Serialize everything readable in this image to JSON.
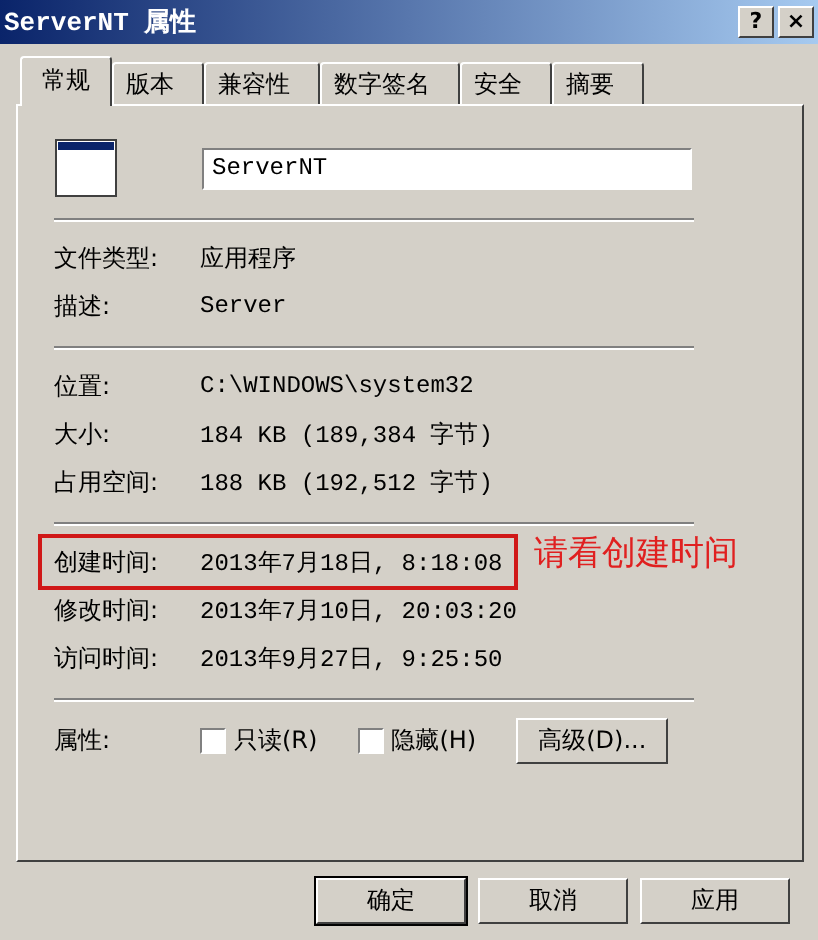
{
  "window": {
    "title": "ServerNT 属性",
    "help_button": "?",
    "close_button": "×"
  },
  "tabs": [
    {
      "label": "常规",
      "selected": true
    },
    {
      "label": "版本",
      "selected": false
    },
    {
      "label": "兼容性",
      "selected": false
    },
    {
      "label": "数字签名",
      "selected": false
    },
    {
      "label": "安全",
      "selected": false
    },
    {
      "label": "摘要",
      "selected": false
    }
  ],
  "name_field": {
    "value": "ServerNT"
  },
  "groups": [
    [
      {
        "label": "文件类型:",
        "value": "应用程序",
        "kind": "text",
        "highlighted": false
      },
      {
        "label": "描述:",
        "value": "Server",
        "kind": "mono",
        "highlighted": false
      }
    ],
    [
      {
        "label": "位置:",
        "value": "C:\\WINDOWS\\system32",
        "kind": "mono",
        "highlighted": false
      },
      {
        "label": "大小:",
        "value": "184 KB (189,384 字节)",
        "kind": "mono",
        "highlighted": false
      },
      {
        "label": "占用空间:",
        "value": "188 KB (192,512 字节)",
        "kind": "mono",
        "highlighted": false
      }
    ],
    [
      {
        "label": "创建时间:",
        "value": "2013年7月18日, 8:18:08",
        "kind": "mono",
        "highlighted": true,
        "annotation": "请看创建时间"
      },
      {
        "label": "修改时间:",
        "value": "2013年7月10日, 20:03:20",
        "kind": "mono",
        "highlighted": false
      },
      {
        "label": "访问时间:",
        "value": "2013年9月27日, 9:25:50",
        "kind": "mono",
        "highlighted": false
      }
    ]
  ],
  "attributes": {
    "label": "属性:",
    "checkboxes": [
      {
        "label": "只读(R)",
        "checked": false
      },
      {
        "label": "隐藏(H)",
        "checked": false
      }
    ],
    "advanced_button": "高级(D)..."
  },
  "buttons": [
    "确定",
    "取消",
    "应用"
  ]
}
